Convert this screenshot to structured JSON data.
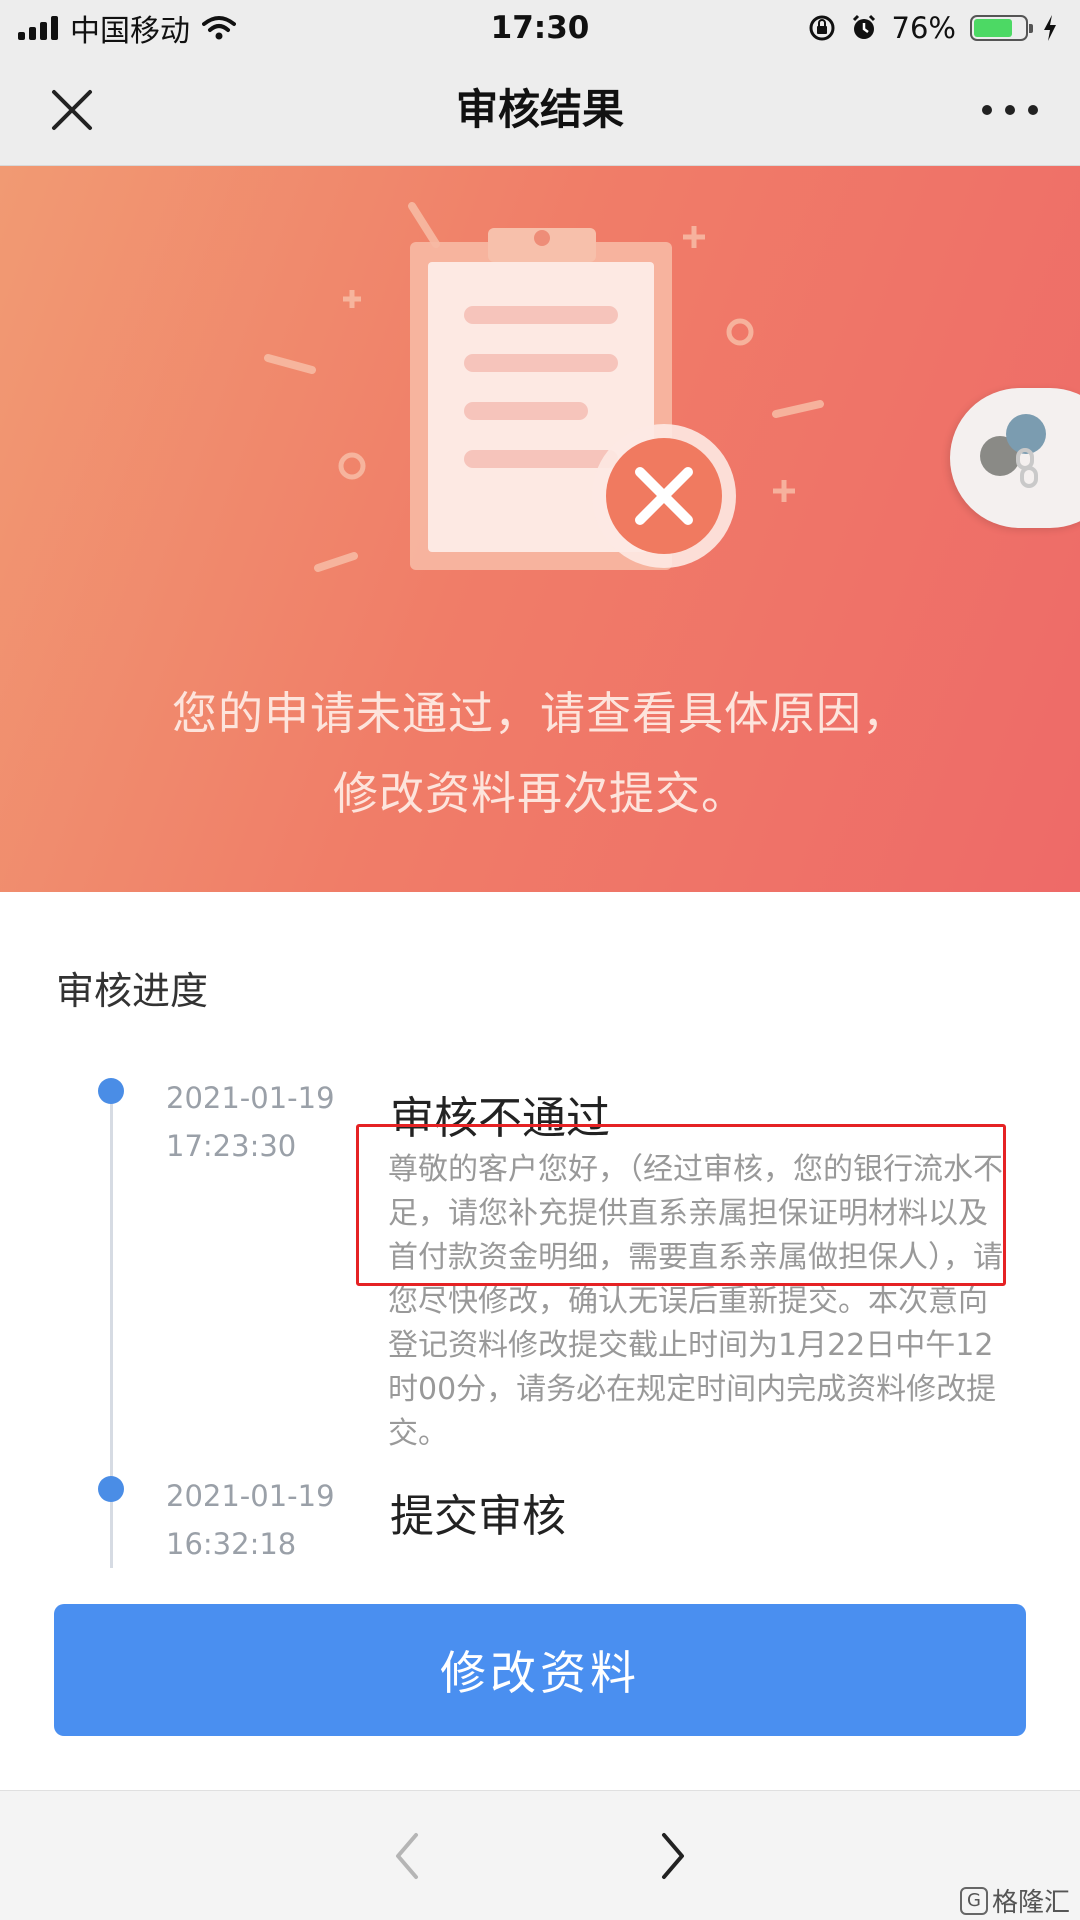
{
  "status_bar": {
    "carrier": "中国移动",
    "time": "17:30",
    "battery_percent": "76%",
    "battery_level": 0.76,
    "battery_color": "#4cd964"
  },
  "nav": {
    "title": "审核结果",
    "close_icon": "close-icon",
    "more_icon": "more-icon"
  },
  "banner": {
    "message_line1": "您的申请未通过，请查看具体原因，",
    "message_line2": "修改资料再次提交。",
    "gradient_colors": [
      "#f19a73",
      "#ee6a68"
    ]
  },
  "progress": {
    "section_title": "审核进度",
    "steps": [
      {
        "date": "2021-01-19",
        "time": "17:23:30",
        "title": "审核不通过",
        "desc": "尊敬的客户您好，（经过审核，您的银行流水不足，请您补充提供直系亲属担保证明材料以及首付款资金明细，需要直系亲属做担保人），请您尽快修改，确认无误后重新提交。本次意向登记资料修改提交截止时间为1月22日中午12时00分，请务必在规定时间内完成资料修改提交。"
      },
      {
        "date": "2021-01-19",
        "time": "16:32:18",
        "title": "提交审核"
      }
    ],
    "dot_color": "#4a8de6",
    "highlight_color": "#e52224"
  },
  "primary_button": {
    "label": "修改资料",
    "color": "#4a8ff0"
  },
  "bottom_nav": {
    "back_icon": "chevron-left-icon",
    "forward_icon": "chevron-right-icon"
  },
  "watermark": {
    "logo_text": "G",
    "text": "格隆汇"
  }
}
